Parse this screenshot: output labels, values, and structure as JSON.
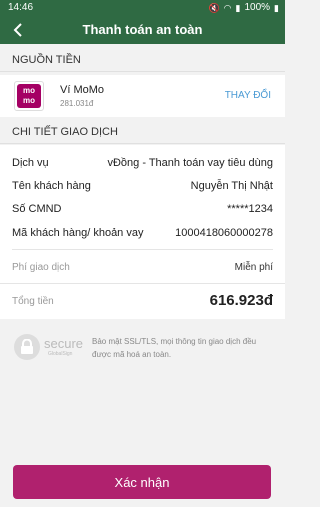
{
  "status_bar": {
    "time": "14:46",
    "battery": "100%"
  },
  "header": {
    "title": "Thanh toán an toàn"
  },
  "funding_source": {
    "section_title": "NGUỒN TIỀN",
    "logo_text": "mo mo",
    "wallet_name": "Ví MoMo",
    "balance": "281.031đ",
    "change_label": "THAY ĐỔI"
  },
  "transaction_details": {
    "section_title": "CHI TIẾT GIAO DỊCH",
    "rows": [
      {
        "label": "Dịch vụ",
        "value": "vĐồng  - Thanh toán vay tiêu dùng"
      },
      {
        "label": "Tên khách hàng",
        "value": "Nguyễn Thị Nhật"
      },
      {
        "label": "Số CMND",
        "value": "*****1234"
      },
      {
        "label": "Mã khách hàng/ khoản vay",
        "value": "1000418060000278"
      }
    ],
    "fee": {
      "label": "Phí giao dịch",
      "value": "Miễn phí"
    },
    "total": {
      "label": "Tổng tiền",
      "value": "616.923đ"
    }
  },
  "security": {
    "badge_text": "secure",
    "badge_sub": "GlobalSign",
    "description": "Bảo mật SSL/TLS, mọi thông tin giao dịch đều được mã hoá an toàn."
  },
  "actions": {
    "confirm_label": "Xác nhận"
  },
  "colors": {
    "header_green": "#2f6a43",
    "momo_pink": "#a50064",
    "button_pink": "#b0216e",
    "link_blue": "#4a9ad4"
  }
}
